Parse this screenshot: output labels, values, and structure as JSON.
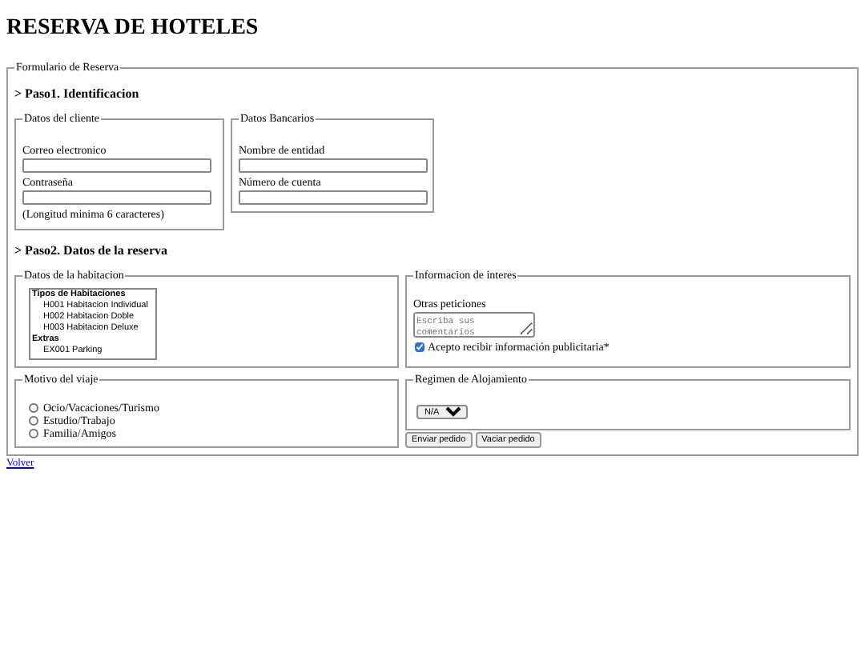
{
  "title": "RESERVA DE HOTELES",
  "form": {
    "legend": "Formulario de Reserva",
    "step1": {
      "heading": "> Paso1. Identificacion",
      "client": {
        "legend": "Datos del cliente",
        "fields": [
          {
            "label": "Correo electronico"
          },
          {
            "label": "Contraseña"
          }
        ],
        "hint": "(Longitud minima 6 caracteres)"
      },
      "bank": {
        "legend": "Datos Bancarios",
        "fields": [
          {
            "label": "Nombre de entidad"
          },
          {
            "label": "Número de cuenta"
          }
        ]
      }
    },
    "step2": {
      "heading": "> Paso2. Datos de la reserva",
      "room": {
        "legend": "Datos de la habitacion",
        "groups": [
          {
            "label": "Tipos de Habitaciones",
            "options": [
              {
                "text": "H001 Habitacion Individual",
                "selected": false
              },
              {
                "text": "H002 Habitacion Doble",
                "selected": false
              },
              {
                "text": "H003 Habitacion Deluxe",
                "selected": false
              }
            ]
          },
          {
            "label": "Extras",
            "options": [
              {
                "text": "EX001 Parking",
                "selected": false
              }
            ]
          }
        ]
      },
      "interest": {
        "legend": "Informacion de interes",
        "label": "Otras peticiones",
        "placeholder": "Escriba sus comentarios",
        "checkbox": {
          "label": "Acepto recibir información publicitaria*",
          "checked": true
        }
      },
      "motive": {
        "legend": "Motivo del viaje",
        "options": [
          {
            "label": "Ocio/Vacaciones/Turismo",
            "selected": false
          },
          {
            "label": "Estudio/Trabajo",
            "selected": false
          },
          {
            "label": "Familia/Amigos",
            "selected": false
          }
        ]
      },
      "regimen": {
        "legend": "Regimen de Alojamiento",
        "value": "N/A"
      },
      "buttons": [
        "Enviar pedido",
        "Vaciar pedido"
      ]
    }
  },
  "link": "Volver"
}
